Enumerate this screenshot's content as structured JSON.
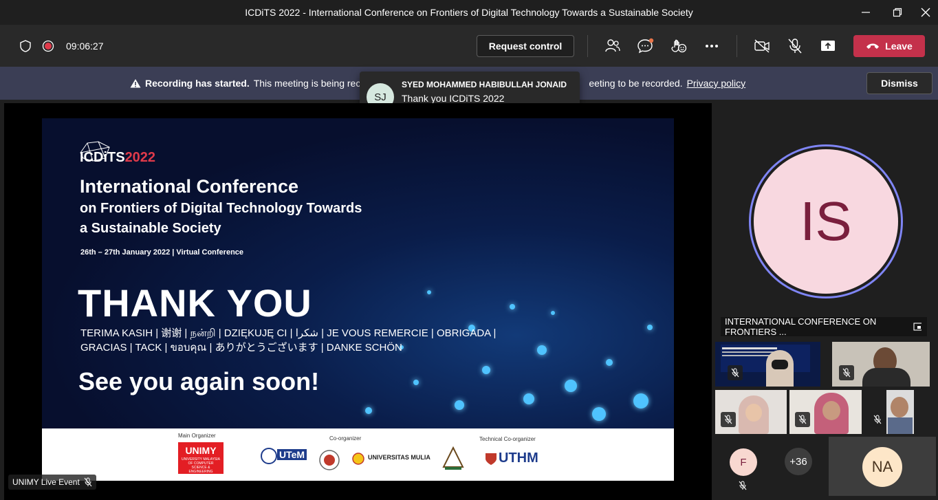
{
  "window": {
    "title": "ICDiTS 2022 - International Conference on Frontiers of Digital Technology Towards a Sustainable Society"
  },
  "toolbar": {
    "timer": "09:06:27",
    "request_control": "Request control",
    "leave": "Leave"
  },
  "banner": {
    "bold": "Recording has started.",
    "text": "This meeting is being rec",
    "text_tail": "eeting to be recorded.",
    "link": "Privacy policy",
    "dismiss": "Dismiss"
  },
  "toast": {
    "initials": "SJ",
    "sender": "SYED MOHAMMED HABIBULLAH JONAID",
    "message": "Thank you ICDiTS 2022"
  },
  "slide": {
    "logo_prefix": "ICDiTS",
    "logo_year": "2022",
    "title_line1": "International Conference",
    "title_line2": "on Frontiers of Digital Technology Towards",
    "title_line3": "a Sustainable Society",
    "date": "26th – 27th January 2022 | Virtual Conference",
    "thank_you": "THANK YOU",
    "languages_line1": "TERIMA KASIH | 谢谢 | நன்றி | DZIĘKUJĘ CI | شكرا | JE VOUS REMERCIE | OBRIGADA |",
    "languages_line2": "GRACIAS | TACK | ขอบคุณ | ありがとうございます | DANKE SCHÖN",
    "see_you": "See you again soon!",
    "main_organizer_label": "Main Organizer",
    "co_organizer_label": "Co-organizer",
    "tech_co_organizer_label": "Technical Co-organizer",
    "unimy": "UNIMY",
    "unimy_sub": "UNIVERSITY MALAYSIA OF COMPUTER SCIENCE & ENGINEERING",
    "utem": "UTeM",
    "mulia": "UNIVERSITAS MULIA",
    "uthm": "UTHM"
  },
  "stage": {
    "live_label": "UNIMY Live Event"
  },
  "participants": {
    "big_initials": "IS",
    "share_label": "INTERNATIONAL CONFERENCE ON FRONTIERS ...",
    "f_initial": "F",
    "more_count": "+36",
    "na_initials": "NA"
  },
  "colors": {
    "accent": "#7f85f5",
    "leave": "#c4314b",
    "banner": "#3b3e55"
  }
}
